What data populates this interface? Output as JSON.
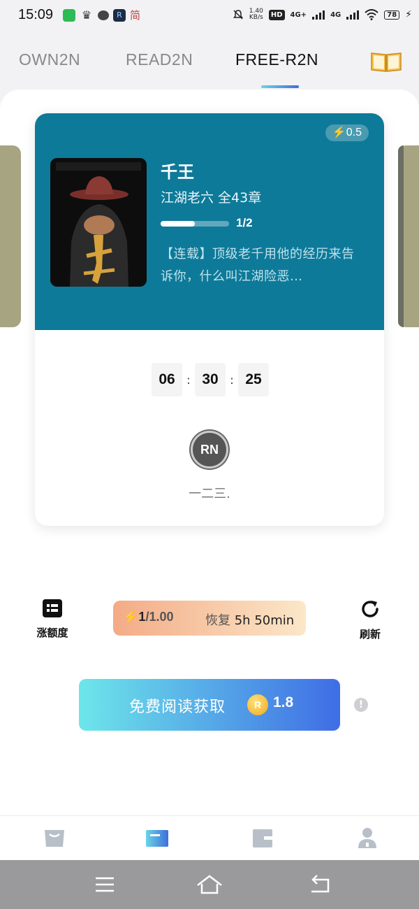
{
  "status_bar": {
    "time": "15:09",
    "notif_text": "简",
    "net_speed_value": "1.40",
    "net_speed_unit": "KB/s",
    "hd_label": "HD",
    "signal1": "4G+",
    "signal2": "4G",
    "battery": "78"
  },
  "tabs": [
    {
      "label": "OWN2N",
      "active": false
    },
    {
      "label": "READ2N",
      "active": false
    },
    {
      "label": "FREE-R2N",
      "active": true
    }
  ],
  "book": {
    "cost": "0.5",
    "title": "千王",
    "meta": "江湖老六 全43章",
    "progress_fraction": 0.5,
    "progress_text": "1/2",
    "description": "【连载】顶级老千用他的经历来告诉你，什么叫江湖险恶…"
  },
  "countdown": {
    "hours": "06",
    "minutes": "30",
    "seconds": "25",
    "separator": ":"
  },
  "author": {
    "avatar_text": "RN",
    "name": "一二三."
  },
  "controls": {
    "quota_label": "涨额度",
    "refresh_label": "刷新",
    "energy_current": "1",
    "energy_max": "/1.00",
    "restore_label": "恢复",
    "restore_time": "5h 50min"
  },
  "claim": {
    "label": "免费阅读获取",
    "coin_symbol": "R",
    "amount": "1.8"
  },
  "colors": {
    "card_top": "#0e7a99",
    "accent_gradient_start": "#6de6ea",
    "accent_gradient_end": "#3f6de5",
    "energy_start": "#f4ab86",
    "energy_end": "#fbe7c8"
  },
  "bottom_nav": [
    {
      "icon": "bag-icon",
      "active": false
    },
    {
      "icon": "reader-icon",
      "active": true
    },
    {
      "icon": "wallet-icon",
      "active": false
    },
    {
      "icon": "profile-icon",
      "active": false
    }
  ],
  "system_nav": [
    "menu-icon",
    "home-icon",
    "back-icon"
  ]
}
